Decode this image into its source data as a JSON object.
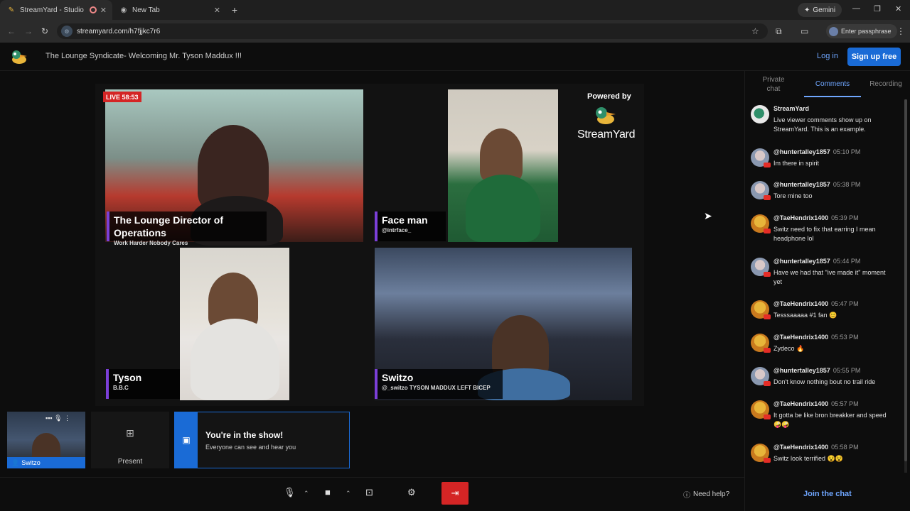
{
  "browser": {
    "tabs": [
      {
        "label": "StreamYard - Studio",
        "active": true
      },
      {
        "label": "New Tab",
        "active": false
      }
    ],
    "new_tab_glyph": "+",
    "gemini_label": "Gemini",
    "url": "streamyard.com/h7fjjkc7r6",
    "passphrase_label": "Enter passphrase"
  },
  "header": {
    "broadcast_title": "The Lounge Syndicate- Welcoming Mr. Tyson Maddux !!!",
    "login_label": "Log in",
    "signup_label": "Sign up free"
  },
  "stage": {
    "live_badge": "LIVE 58:53",
    "powered_by": "Powered by",
    "brand_word": "StreamYard",
    "participants": [
      {
        "name": "The Lounge Director of Operations",
        "subtitle": "Work Harder Nobody Cares"
      },
      {
        "name": "Face man",
        "subtitle": "@intrface_"
      },
      {
        "name": "Tyson",
        "subtitle": "B.B.C"
      },
      {
        "name": "Switzo",
        "subtitle": "@_switzo TYSON MADDUX LEFT BICEP"
      }
    ]
  },
  "bottom": {
    "self_name": "Switzo",
    "present_label": "Present",
    "in_show_title": "You're in the show!",
    "in_show_sub": "Everyone can see and hear you",
    "help_label": "Need help?"
  },
  "panel": {
    "tabs": [
      "Private chat",
      "Comments",
      "Recording"
    ],
    "active_tab": "Comments",
    "comments": [
      {
        "user": "StreamYard",
        "time": "",
        "text": "Live viewer comments show up on StreamYard. This is an example.",
        "avatar": "streamyard"
      },
      {
        "user": "@huntertalley1857",
        "time": "05:10 PM",
        "text": "Im there in spirit",
        "avatar": "gray"
      },
      {
        "user": "@huntertalley1857",
        "time": "05:38 PM",
        "text": "Tore mine too",
        "avatar": "gray"
      },
      {
        "user": "@TaeHendrix1400",
        "time": "05:39 PM",
        "text": "Switz need to fix that earring I mean headphone lol",
        "avatar": "gold"
      },
      {
        "user": "@huntertalley1857",
        "time": "05:44 PM",
        "text": "Have we had that \"ive made it\" moment yet",
        "avatar": "gray"
      },
      {
        "user": "@TaeHendrix1400",
        "time": "05:47 PM",
        "text": "Tesssaaaaa #1 fan 😊",
        "avatar": "gold"
      },
      {
        "user": "@TaeHendrix1400",
        "time": "05:53 PM",
        "text": "Zydeco 🔥",
        "avatar": "gold"
      },
      {
        "user": "@huntertalley1857",
        "time": "05:55 PM",
        "text": "Don't know nothing bout no trail ride",
        "avatar": "gray"
      },
      {
        "user": "@TaeHendrix1400",
        "time": "05:57 PM",
        "text": "It gotta be like bron breakker and speed 🤪🤪",
        "avatar": "gold"
      },
      {
        "user": "@TaeHendrix1400",
        "time": "05:58 PM",
        "text": "Switz look terrified 😵😵",
        "avatar": "gold"
      }
    ],
    "join_label": "Join the chat"
  },
  "colors": {
    "accent": "#1a6bd6",
    "live": "#d42525",
    "nameplate_bar": "#7b3fd8",
    "link": "#6fa6ff"
  }
}
